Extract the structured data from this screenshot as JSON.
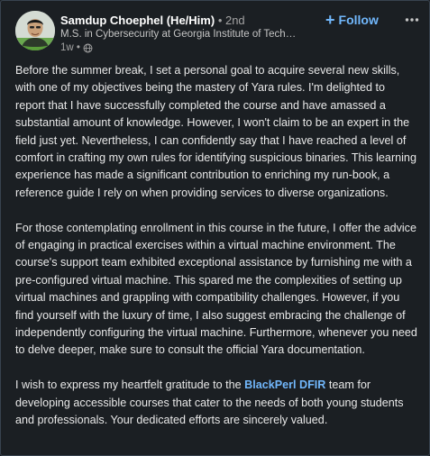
{
  "post": {
    "author": {
      "name": "Samdup Choephel (He/Him)",
      "degree": "• 2nd",
      "headline": "M.S. in Cybersecurity at Georgia Institute of Techn...",
      "time": "1w •",
      "visibility_icon": "globe-icon"
    },
    "follow_label": "Follow",
    "follow_icon": "plus-icon",
    "more_icon": "ellipsis-icon",
    "paragraphs": [
      "Before the summer break, I set a personal goal to acquire several new skills, with one of my objectives being the mastery of Yara rules. I'm delighted to report that I have successfully completed the course and have amassed a substantial amount of knowledge. However, I won't claim to be an expert in the field just yet. Nevertheless, I can confidently say that I have reached a level of comfort in crafting my own rules for identifying suspicious binaries. This learning experience has made a significant contribution to enriching my run-book, a reference guide I rely on when providing services to diverse organizations.",
      "For those contemplating enrollment in this course in the future, I offer the advice of engaging in practical exercises within a virtual machine environment. The course's support team exhibited exceptional assistance by furnishing me with a pre-configured virtual machine. This spared me the complexities of setting up virtual machines and grappling with compatibility challenges. However, if you find yourself with the luxury of time, I also suggest embracing the challenge of independently configuring the virtual machine. Furthermore, whenever you need to delve deeper, make sure to consult the official Yara documentation."
    ],
    "closing": {
      "before": "I wish to express my heartfelt gratitude to the ",
      "mention": "BlackPerl DFIR",
      "after": " team for developing accessible courses that cater to the needs of both young students and professionals. Your dedicated efforts are sincerely valued."
    },
    "colors": {
      "background": "#1b1f23",
      "accent": "#71b7fb",
      "text": "#e8e8e8"
    }
  }
}
